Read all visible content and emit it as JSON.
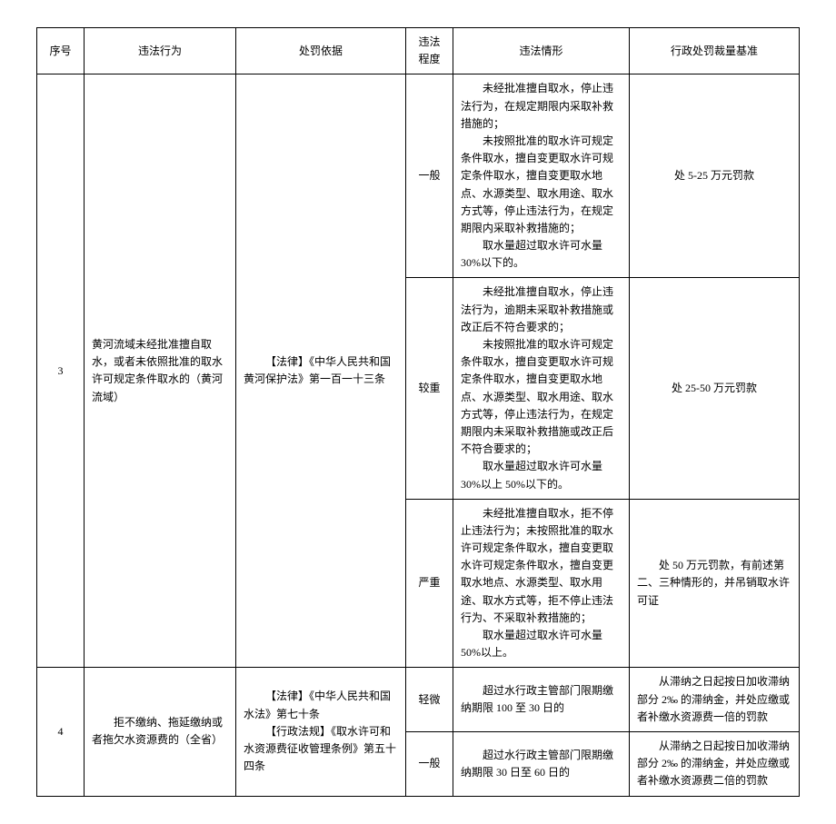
{
  "headers": {
    "seq": "序号",
    "behavior": "违法行为",
    "basis": "处罚依据",
    "severity": "违法程度",
    "circumstance": "违法情形",
    "penalty": "行政处罚裁量基准"
  },
  "rows": [
    {
      "seq": "3",
      "behavior": "黄河流域未经批准擅自取水，或者未依照批准的取水许可规定条件取水的（黄河流域）",
      "basis": "【法律】《中华人民共和国黄河保护法》第一百一十三条",
      "sub": [
        {
          "severity": "一般",
          "circumstance_p1": "未经批准擅自取水，停止违法行为，在规定期限内采取补救措施的；",
          "circumstance_p2": "未按照批准的取水许可规定条件取水，擅自变更取水许可规定条件取水，擅自变更取水地点、水源类型、取水用途、取水方式等，停止违法行为，在规定期限内采取补救措施的；",
          "circumstance_p3": "取水量超过取水许可水量 30%以下的。",
          "penalty": "处 5-25 万元罚款"
        },
        {
          "severity": "较重",
          "circumstance_p1": "未经批准擅自取水，停止违法行为，逾期未采取补救措施或改正后不符合要求的；",
          "circumstance_p2": "未按照批准的取水许可规定条件取水，擅自变更取水许可规定条件取水，擅自变更取水地点、水源类型、取水用途、取水方式等，停止违法行为，在规定期限内未采取补救措施或改正后不符合要求的；",
          "circumstance_p3": "取水量超过取水许可水量 30%以上 50%以下的。",
          "penalty": "处 25-50 万元罚款"
        },
        {
          "severity": "严重",
          "circumstance_p1": "未经批准擅自取水，拒不停止违法行为；未按照批准的取水许可规定条件取水，擅自变更取水许可规定条件取水，擅自变更取水地点、水源类型、取水用途、取水方式等，拒不停止违法行为、不采取补救措施的；",
          "circumstance_p2": "取水量超过取水许可水量 50%以上。",
          "penalty": "处 50 万元罚款，有前述第二、三种情形的，并吊销取水许可证"
        }
      ]
    },
    {
      "seq": "4",
      "behavior": "拒不缴纳、拖延缴纳或者拖欠水资源费的（全省）",
      "basis_p1": "【法律】《中华人民共和国水法》第七十条",
      "basis_p2": "【行政法规】《取水许可和水资源费征收管理条例》第五十四条",
      "sub": [
        {
          "severity": "轻微",
          "circumstance": "超过水行政主管部门限期缴纳期限 100 至 30 日的",
          "penalty": "从滞纳之日起按日加收滞纳部分 2‰ 的滞纳金，并处应缴或者补缴水资源费一倍的罚款"
        },
        {
          "severity": "一般",
          "circumstance": "超过水行政主管部门限期缴纳期限 30 日至 60 日的",
          "penalty": "从滞纳之日起按日加收滞纳部分 2‰ 的滞纳金，并处应缴或者补缴水资源费二倍的罚款"
        }
      ]
    }
  ]
}
